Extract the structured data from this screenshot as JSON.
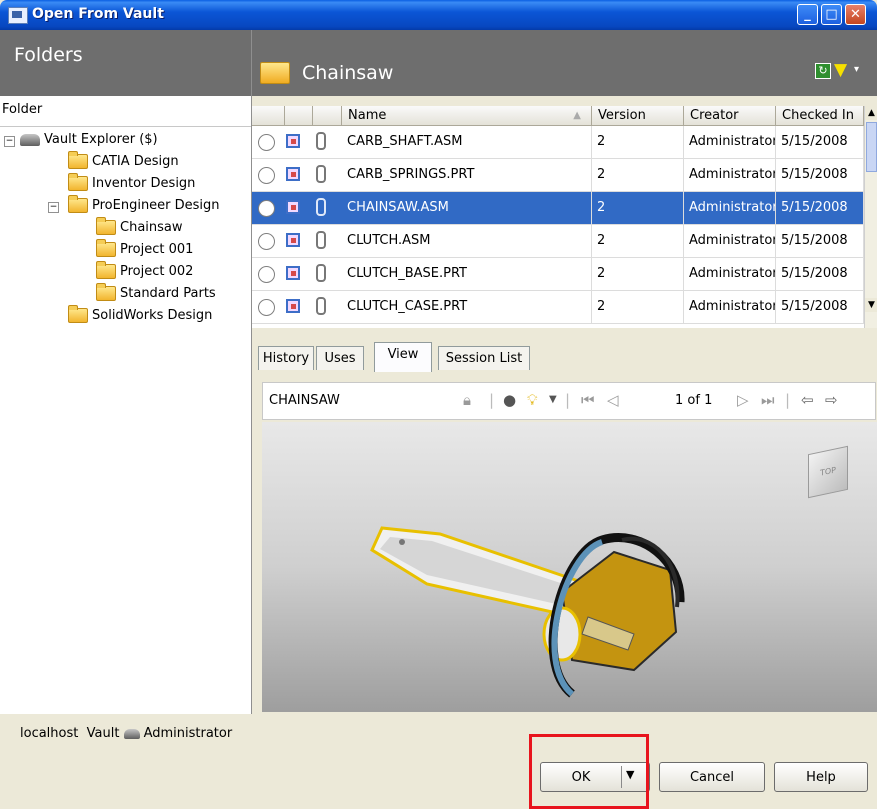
{
  "window": {
    "title": "Open From Vault",
    "controls": [
      "minimize",
      "maximize",
      "close"
    ]
  },
  "folders_pane": {
    "title": "Folders",
    "column_header": "Folder",
    "tree": [
      {
        "label": "Vault Explorer ($)",
        "level": 0,
        "expander": "−",
        "icon": "vault-icon"
      },
      {
        "label": "CATIA Design",
        "level": 1,
        "icon": "folder-icon"
      },
      {
        "label": "Inventor Design",
        "level": 1,
        "icon": "folder-icon"
      },
      {
        "label": "ProEngineer Design",
        "level": 1,
        "expander": "−",
        "icon": "folder-icon"
      },
      {
        "label": "Chainsaw",
        "level": 2,
        "icon": "folder-icon"
      },
      {
        "label": "Project 001",
        "level": 2,
        "icon": "folder-icon"
      },
      {
        "label": "Project 002",
        "level": 2,
        "icon": "folder-icon"
      },
      {
        "label": "Standard Parts",
        "level": 2,
        "icon": "folder-icon"
      },
      {
        "label": "SolidWorks Design",
        "level": 1,
        "icon": "folder-icon"
      }
    ]
  },
  "files_pane": {
    "folder_title": "Chainsaw",
    "columns": [
      "Name",
      "Version",
      "Creator",
      "Checked In"
    ],
    "rows": [
      {
        "name": "CARB_SHAFT.ASM",
        "version": "2",
        "creator": "Administrator",
        "checked_in": "5/15/2008"
      },
      {
        "name": "CARB_SPRINGS.PRT",
        "version": "2",
        "creator": "Administrator",
        "checked_in": "5/15/2008"
      },
      {
        "name": "CHAINSAW.ASM",
        "version": "2",
        "creator": "Administrator",
        "checked_in": "5/15/2008",
        "selected": true
      },
      {
        "name": "CLUTCH.ASM",
        "version": "2",
        "creator": "Administrator",
        "checked_in": "5/15/2008"
      },
      {
        "name": "CLUTCH_BASE.PRT",
        "version": "2",
        "creator": "Administrator",
        "checked_in": "5/15/2008"
      },
      {
        "name": "CLUTCH_CASE.PRT",
        "version": "2",
        "creator": "Administrator",
        "checked_in": "5/15/2008"
      }
    ]
  },
  "tabs": [
    "History",
    "Uses",
    "View",
    "Session List"
  ],
  "active_tab": "View",
  "viewer": {
    "model_name": "CHAINSAW",
    "page_indicator": "1 of 1",
    "view_cube_label": "TOP"
  },
  "status_bar": {
    "server": "localhost",
    "vault": "Vault",
    "user": "Administrator"
  },
  "buttons": {
    "ok": "OK",
    "cancel": "Cancel",
    "help": "Help"
  },
  "colors": {
    "selection": "#316ac5",
    "pane_header": "#6e6e6e",
    "highlight_box": "#e8141d"
  }
}
